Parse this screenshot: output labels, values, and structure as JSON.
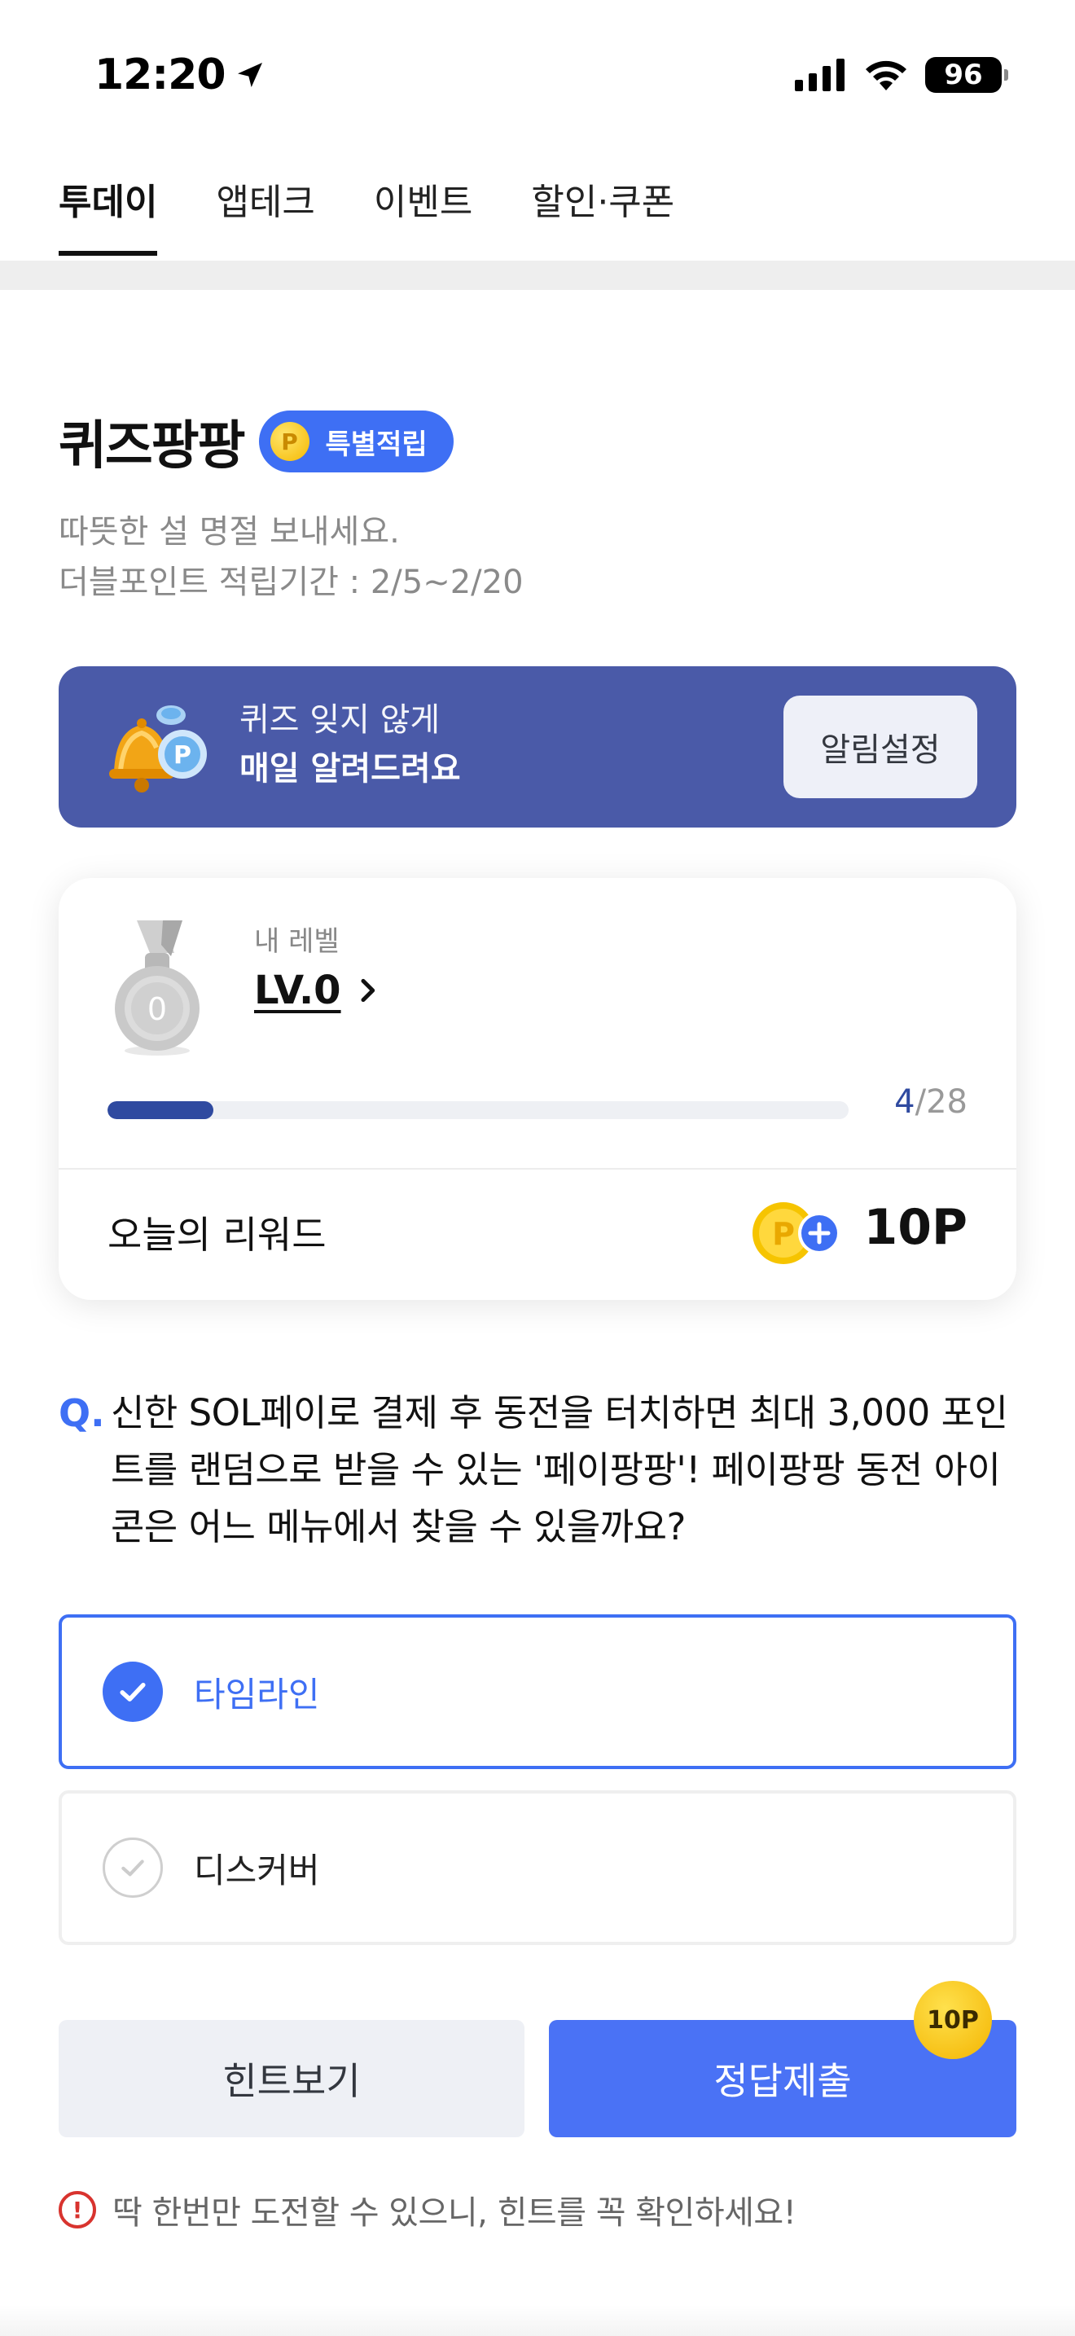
{
  "status_bar": {
    "time": "12:20",
    "battery": "96",
    "location_icon": "location-arrow-icon",
    "signal_icon": "cellular-signal-icon",
    "wifi_icon": "wifi-icon"
  },
  "tabs": [
    {
      "label": "투데이",
      "active": true
    },
    {
      "label": "앱테크",
      "active": false
    },
    {
      "label": "이벤트",
      "active": false
    },
    {
      "label": "할인·쿠폰",
      "active": false
    }
  ],
  "quiz": {
    "title": "퀴즈팡팡",
    "badge": "특별적립",
    "badge_coin": "P",
    "description_line1": "따뜻한 설 명절 보내세요.",
    "description_line2": "더블포인트 적립기간 : 2/5~2/20"
  },
  "alarm": {
    "line1": "퀴즈 잊지 않게",
    "line2": "매일 알려드려요",
    "button": "알림설정",
    "icon": "bell-coin-icon"
  },
  "level": {
    "caption": "내 레벨",
    "value": "LV.0",
    "medal_number": "0",
    "progress_current": "4",
    "progress_total": "/28",
    "progress_fraction": 0.143,
    "reward_label": "오늘의 리워드",
    "reward_value": "10P",
    "reward_coin": "P"
  },
  "question": {
    "mark": "Q.",
    "text": "신한 SOL페이로 결제 후 동전을 터치하면 최대 3,000 포인트를 랜덤으로 받을 수 있는 '페이팡팡'! 페이팡팡 동전 아이콘은 어느 메뉴에서 찾을 수 있을까요?"
  },
  "options": [
    {
      "label": "타임라인",
      "selected": true
    },
    {
      "label": "디스커버",
      "selected": false
    }
  ],
  "actions": {
    "hint": "힌트보기",
    "submit": "정답제출",
    "submit_badge": "10P"
  },
  "notice": {
    "icon_text": "!",
    "text": "딱 한번만 도전할 수 있으니, 힌트를 꼭 확인하세요!"
  },
  "colors": {
    "accent": "#3e6ff4",
    "banner": "#4a5aa8",
    "progress": "#2f4aa0",
    "warning": "#d8332e"
  }
}
